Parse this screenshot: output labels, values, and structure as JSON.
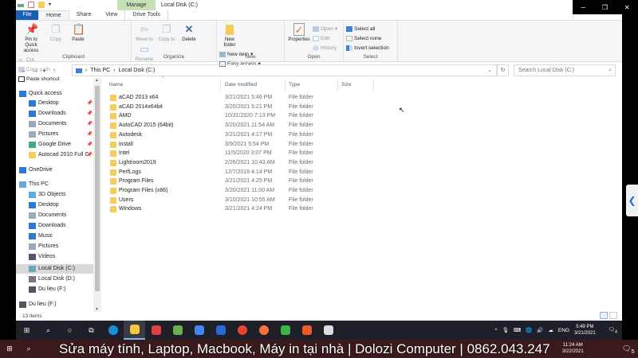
{
  "window": {
    "title": "Local Disk (C:)",
    "context_tab": "Manage",
    "controls": {
      "minimize": "─",
      "maximize": "❐",
      "close": "✕"
    }
  },
  "tabs": [
    {
      "label": "File"
    },
    {
      "label": "Home"
    },
    {
      "label": "Share"
    },
    {
      "label": "View"
    },
    {
      "label": "Drive Tools"
    }
  ],
  "ribbon": {
    "clipboard": {
      "label": "Clipboard",
      "pin": "Pin to Quick access",
      "copy": "Copy",
      "paste": "Paste",
      "cut": "Cut",
      "copy_path": "Copy path",
      "paste_shortcut": "Paste shortcut"
    },
    "organize": {
      "label": "Organize",
      "move_to": "Move to",
      "copy_to": "Copy to",
      "delete": "Delete",
      "rename": "Rename"
    },
    "new": {
      "label": "New",
      "new_folder": "New folder",
      "new_item": "New item",
      "easy_access": "Easy access"
    },
    "open": {
      "label": "Open",
      "properties": "Properties",
      "open": "Open",
      "edit": "Edit",
      "history": "History"
    },
    "select": {
      "label": "Select",
      "select_all": "Select all",
      "select_none": "Select none",
      "invert": "Invert selection"
    }
  },
  "address": {
    "crumbs": [
      "This PC",
      "Local Disk (C:)"
    ],
    "separator": "›",
    "search_placeholder": "Search Local Disk (C:)"
  },
  "nav": [
    {
      "label": "Quick access",
      "pinned": false
    },
    {
      "label": "Desktop",
      "pinned": true
    },
    {
      "label": "Downloads",
      "pinned": true
    },
    {
      "label": "Documents",
      "pinned": true
    },
    {
      "label": "Pictures",
      "pinned": true
    },
    {
      "label": "Google Drive",
      "pinned": true
    },
    {
      "label": "Autocad 2010 Full C",
      "pinned": true
    },
    {
      "label": "OneDrive"
    },
    {
      "label": "This PC"
    },
    {
      "label": "3D Objects"
    },
    {
      "label": "Desktop"
    },
    {
      "label": "Documents"
    },
    {
      "label": "Downloads"
    },
    {
      "label": "Music"
    },
    {
      "label": "Pictures"
    },
    {
      "label": "Videos"
    },
    {
      "label": "Local Disk (C:)",
      "selected": true
    },
    {
      "label": "Local Disk (D:)"
    },
    {
      "label": "Du lieu (F:)"
    },
    {
      "label": "Du lieu (F:)"
    }
  ],
  "columns": {
    "name": "Name",
    "date": "Date modified",
    "type": "Type",
    "size": "Size"
  },
  "files": [
    {
      "name": "aCAD 2013 x64",
      "date": "3/21/2021 5:46 PM",
      "type": "File folder"
    },
    {
      "name": "aCAD 2014x64bit",
      "date": "3/20/2021 5:21 PM",
      "type": "File folder"
    },
    {
      "name": "AMD",
      "date": "10/31/2020 7:13 PM",
      "type": "File folder"
    },
    {
      "name": "AutoCAD 2015 (64bit)",
      "date": "3/20/2021 11:54 AM",
      "type": "File folder"
    },
    {
      "name": "Autodesk",
      "date": "3/21/2021 4:17 PM",
      "type": "File folder"
    },
    {
      "name": "install",
      "date": "3/9/2021 5:54 PM",
      "type": "File folder"
    },
    {
      "name": "Intel",
      "date": "11/5/2020 3:07 PM",
      "type": "File folder"
    },
    {
      "name": "Lightroom2019",
      "date": "2/26/2021 10:43 AM",
      "type": "File folder"
    },
    {
      "name": "PerfLogs",
      "date": "12/7/2019 4:14 PM",
      "type": "File folder"
    },
    {
      "name": "Program Files",
      "date": "3/21/2021 4:25 PM",
      "type": "File folder"
    },
    {
      "name": "Program Files (x86)",
      "date": "3/20/2021 11:00 AM",
      "type": "File folder"
    },
    {
      "name": "Users",
      "date": "3/10/2021 10:55 AM",
      "type": "File folder"
    },
    {
      "name": "Windows",
      "date": "3/21/2021 4:24 PM",
      "type": "File folder"
    }
  ],
  "status": {
    "items": "13 items"
  },
  "taskbar": {
    "lang": "ENG",
    "time": "5:49 PM",
    "date": "3/21/2021",
    "notifications": "4",
    "apps": [
      "edge",
      "file-explorer",
      "app",
      "app-green",
      "google",
      "app-blue",
      "chrome",
      "firefox",
      "camtasia-green",
      "camtasia-orange",
      "defender"
    ]
  },
  "banner": {
    "text": "Sửa máy tính, Laptop, Macbook, Máy in tại nhà | Dolozi Computer | 0862.043.247",
    "time": "11:24 AM",
    "date": "3/22/2021",
    "notifications": "5"
  }
}
